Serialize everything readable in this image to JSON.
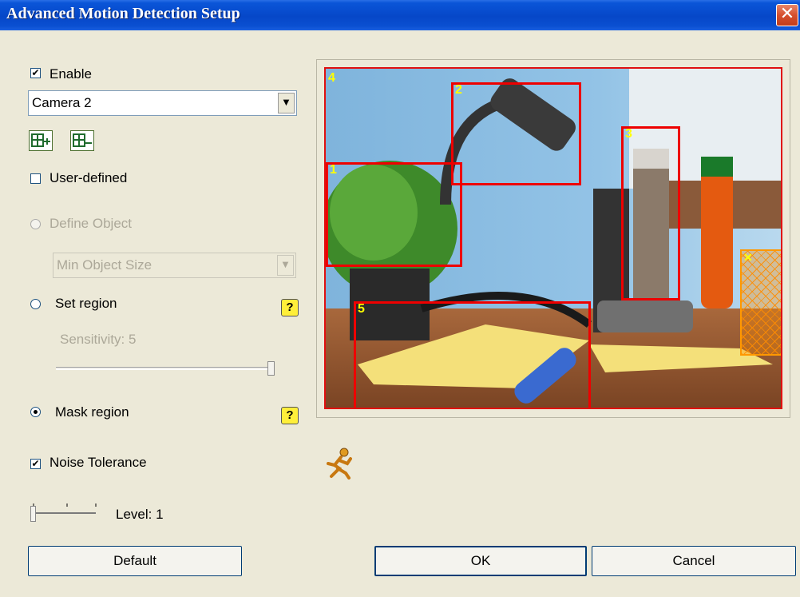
{
  "window": {
    "title": "Advanced Motion Detection Setup",
    "close_glyph": "✕"
  },
  "enable": {
    "label": "Enable",
    "checked": true
  },
  "camera": {
    "selected": "Camera 2"
  },
  "icons": {
    "add_region": "grid-add-icon",
    "remove_region": "grid-remove-icon"
  },
  "user_defined": {
    "label": "User-defined",
    "checked": false
  },
  "define_object": {
    "label": "Define Object",
    "enabled": false
  },
  "object_size": {
    "selected": "Min Object Size",
    "enabled": false
  },
  "set_region": {
    "label": "Set region",
    "help": "?"
  },
  "sensitivity": {
    "label": "Sensitivity: 5",
    "value": 5,
    "enabled": false
  },
  "mask_region": {
    "label": "Mask region",
    "checked": true,
    "help": "?"
  },
  "noise_tolerance": {
    "label": "Noise Tolerance",
    "checked": true
  },
  "level": {
    "label": "Level: 1",
    "value": 1
  },
  "buttons": {
    "default": "Default",
    "ok": "OK",
    "cancel": "Cancel"
  },
  "regions": [
    {
      "num": "1"
    },
    {
      "num": "2"
    },
    {
      "num": "3"
    },
    {
      "num": "4"
    },
    {
      "num": "5"
    }
  ],
  "mask_marker": "✕",
  "colors": {
    "region_border": "#e00000",
    "region_label": "#ffff00",
    "mask": "#ff9800",
    "titlebar": "#0a55d8"
  }
}
